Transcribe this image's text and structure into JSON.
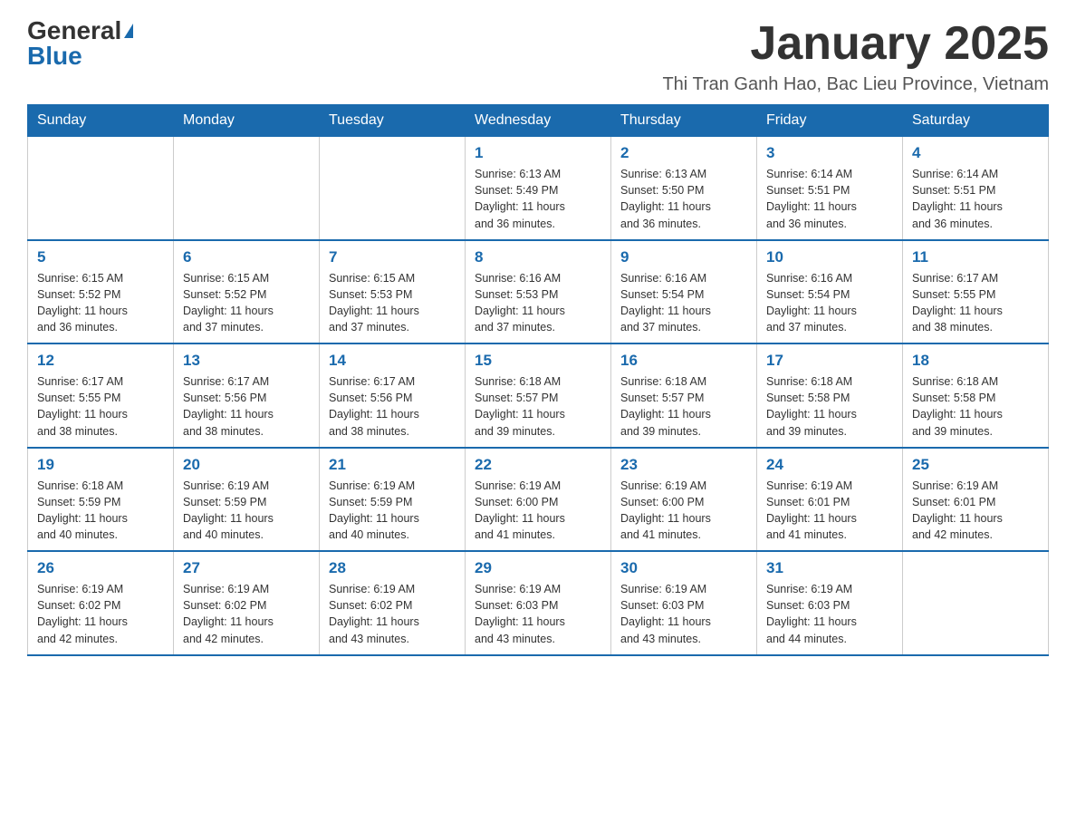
{
  "header": {
    "logo_general": "General",
    "logo_blue": "Blue",
    "month_title": "January 2025",
    "location": "Thi Tran Ganh Hao, Bac Lieu Province, Vietnam"
  },
  "days_of_week": [
    "Sunday",
    "Monday",
    "Tuesday",
    "Wednesday",
    "Thursday",
    "Friday",
    "Saturday"
  ],
  "weeks": [
    [
      {
        "day": "",
        "info": ""
      },
      {
        "day": "",
        "info": ""
      },
      {
        "day": "",
        "info": ""
      },
      {
        "day": "1",
        "info": "Sunrise: 6:13 AM\nSunset: 5:49 PM\nDaylight: 11 hours\nand 36 minutes."
      },
      {
        "day": "2",
        "info": "Sunrise: 6:13 AM\nSunset: 5:50 PM\nDaylight: 11 hours\nand 36 minutes."
      },
      {
        "day": "3",
        "info": "Sunrise: 6:14 AM\nSunset: 5:51 PM\nDaylight: 11 hours\nand 36 minutes."
      },
      {
        "day": "4",
        "info": "Sunrise: 6:14 AM\nSunset: 5:51 PM\nDaylight: 11 hours\nand 36 minutes."
      }
    ],
    [
      {
        "day": "5",
        "info": "Sunrise: 6:15 AM\nSunset: 5:52 PM\nDaylight: 11 hours\nand 36 minutes."
      },
      {
        "day": "6",
        "info": "Sunrise: 6:15 AM\nSunset: 5:52 PM\nDaylight: 11 hours\nand 37 minutes."
      },
      {
        "day": "7",
        "info": "Sunrise: 6:15 AM\nSunset: 5:53 PM\nDaylight: 11 hours\nand 37 minutes."
      },
      {
        "day": "8",
        "info": "Sunrise: 6:16 AM\nSunset: 5:53 PM\nDaylight: 11 hours\nand 37 minutes."
      },
      {
        "day": "9",
        "info": "Sunrise: 6:16 AM\nSunset: 5:54 PM\nDaylight: 11 hours\nand 37 minutes."
      },
      {
        "day": "10",
        "info": "Sunrise: 6:16 AM\nSunset: 5:54 PM\nDaylight: 11 hours\nand 37 minutes."
      },
      {
        "day": "11",
        "info": "Sunrise: 6:17 AM\nSunset: 5:55 PM\nDaylight: 11 hours\nand 38 minutes."
      }
    ],
    [
      {
        "day": "12",
        "info": "Sunrise: 6:17 AM\nSunset: 5:55 PM\nDaylight: 11 hours\nand 38 minutes."
      },
      {
        "day": "13",
        "info": "Sunrise: 6:17 AM\nSunset: 5:56 PM\nDaylight: 11 hours\nand 38 minutes."
      },
      {
        "day": "14",
        "info": "Sunrise: 6:17 AM\nSunset: 5:56 PM\nDaylight: 11 hours\nand 38 minutes."
      },
      {
        "day": "15",
        "info": "Sunrise: 6:18 AM\nSunset: 5:57 PM\nDaylight: 11 hours\nand 39 minutes."
      },
      {
        "day": "16",
        "info": "Sunrise: 6:18 AM\nSunset: 5:57 PM\nDaylight: 11 hours\nand 39 minutes."
      },
      {
        "day": "17",
        "info": "Sunrise: 6:18 AM\nSunset: 5:58 PM\nDaylight: 11 hours\nand 39 minutes."
      },
      {
        "day": "18",
        "info": "Sunrise: 6:18 AM\nSunset: 5:58 PM\nDaylight: 11 hours\nand 39 minutes."
      }
    ],
    [
      {
        "day": "19",
        "info": "Sunrise: 6:18 AM\nSunset: 5:59 PM\nDaylight: 11 hours\nand 40 minutes."
      },
      {
        "day": "20",
        "info": "Sunrise: 6:19 AM\nSunset: 5:59 PM\nDaylight: 11 hours\nand 40 minutes."
      },
      {
        "day": "21",
        "info": "Sunrise: 6:19 AM\nSunset: 5:59 PM\nDaylight: 11 hours\nand 40 minutes."
      },
      {
        "day": "22",
        "info": "Sunrise: 6:19 AM\nSunset: 6:00 PM\nDaylight: 11 hours\nand 41 minutes."
      },
      {
        "day": "23",
        "info": "Sunrise: 6:19 AM\nSunset: 6:00 PM\nDaylight: 11 hours\nand 41 minutes."
      },
      {
        "day": "24",
        "info": "Sunrise: 6:19 AM\nSunset: 6:01 PM\nDaylight: 11 hours\nand 41 minutes."
      },
      {
        "day": "25",
        "info": "Sunrise: 6:19 AM\nSunset: 6:01 PM\nDaylight: 11 hours\nand 42 minutes."
      }
    ],
    [
      {
        "day": "26",
        "info": "Sunrise: 6:19 AM\nSunset: 6:02 PM\nDaylight: 11 hours\nand 42 minutes."
      },
      {
        "day": "27",
        "info": "Sunrise: 6:19 AM\nSunset: 6:02 PM\nDaylight: 11 hours\nand 42 minutes."
      },
      {
        "day": "28",
        "info": "Sunrise: 6:19 AM\nSunset: 6:02 PM\nDaylight: 11 hours\nand 43 minutes."
      },
      {
        "day": "29",
        "info": "Sunrise: 6:19 AM\nSunset: 6:03 PM\nDaylight: 11 hours\nand 43 minutes."
      },
      {
        "day": "30",
        "info": "Sunrise: 6:19 AM\nSunset: 6:03 PM\nDaylight: 11 hours\nand 43 minutes."
      },
      {
        "day": "31",
        "info": "Sunrise: 6:19 AM\nSunset: 6:03 PM\nDaylight: 11 hours\nand 44 minutes."
      },
      {
        "day": "",
        "info": ""
      }
    ]
  ]
}
